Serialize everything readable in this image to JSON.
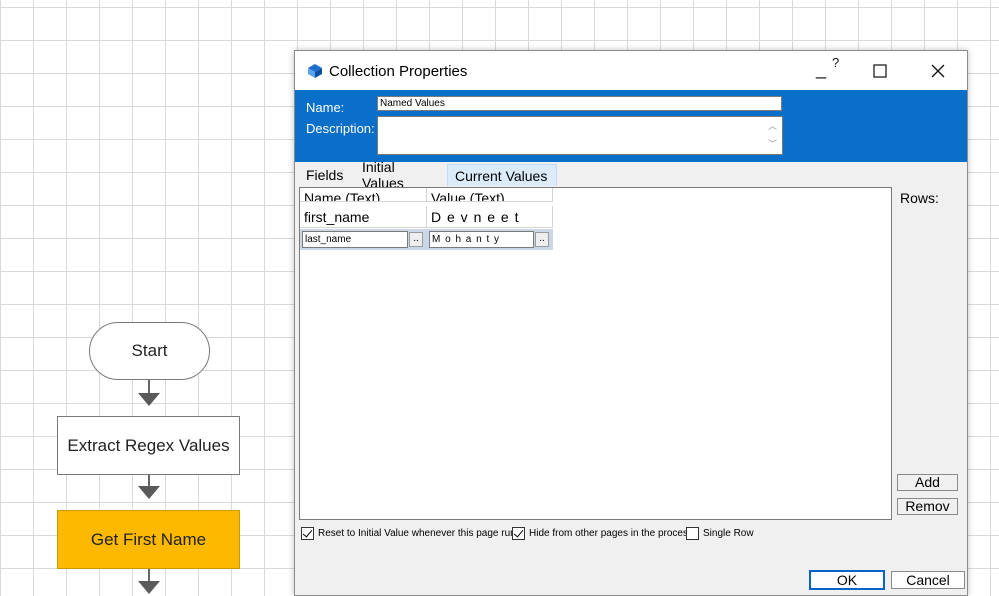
{
  "flowchart": {
    "start_label": "Start",
    "action_label": "Extract Regex Values",
    "calc_label": "Get First Name",
    "calc_color": "#fcb900"
  },
  "dialog": {
    "title": "Collection Properties",
    "help_glyph": "?",
    "minimize_glyph": "_",
    "name_label": "Name:",
    "name_value": "Named Values",
    "description_label": "Description:",
    "description_value": "",
    "header_color": "#0a6fc9",
    "tabs": [
      {
        "label": "Fields"
      },
      {
        "label": "Initial Values"
      },
      {
        "label": "Current Values",
        "active": true
      }
    ],
    "grid": {
      "columns": [
        "Name (Text)",
        "Value (Text)"
      ],
      "rows": [
        [
          "first_name",
          "D e v n e e t"
        ],
        [
          "last_name",
          "M o h a n t y"
        ]
      ],
      "ellipsis_label": ".."
    },
    "rows_label": "Rows:",
    "add_label": "Add",
    "remove_label": "Remov",
    "checkboxes": [
      {
        "label": "Reset to Initial Value whenever this page runs",
        "checked": true
      },
      {
        "label": "Hide from other pages in the process",
        "checked": true
      },
      {
        "label": "Single Row",
        "checked": false
      }
    ],
    "ok_label": "OK",
    "cancel_label": "Cancel"
  }
}
